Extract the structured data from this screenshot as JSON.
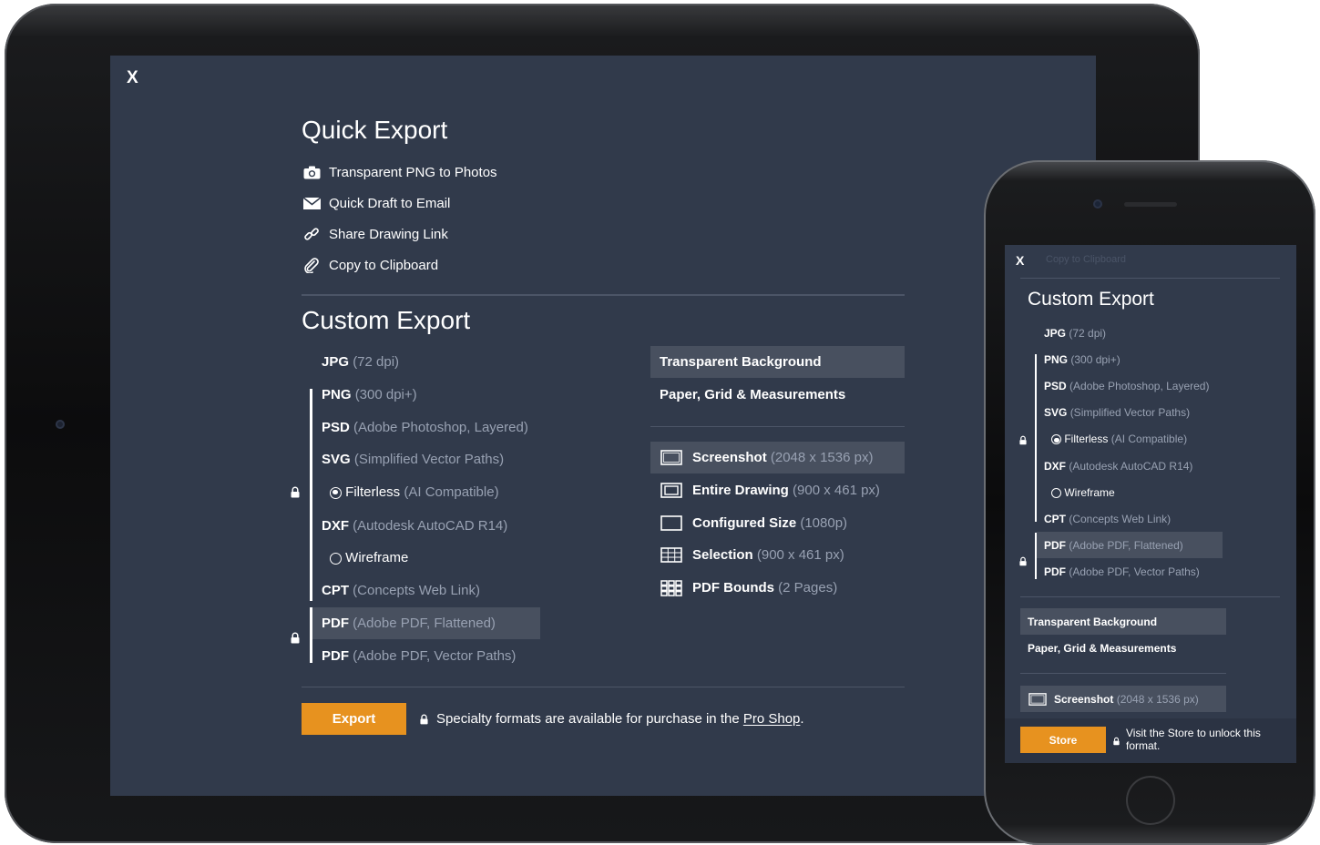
{
  "ipad": {
    "close_label": "X",
    "quick_export": {
      "title": "Quick Export",
      "items": [
        {
          "icon": "camera-icon",
          "label": "Transparent PNG to Photos"
        },
        {
          "icon": "envelope-icon",
          "label": "Quick Draft to Email"
        },
        {
          "icon": "link-icon",
          "label": "Share Drawing Link"
        },
        {
          "icon": "paperclip-icon",
          "label": "Copy to Clipboard"
        }
      ]
    },
    "custom_export": {
      "title": "Custom Export",
      "formats": [
        {
          "name": "JPG",
          "detail": "(72 dpi)"
        },
        {
          "name": "PNG",
          "detail": "(300 dpi+)"
        },
        {
          "name": "PSD",
          "detail": "(Adobe Photoshop, Layered)"
        },
        {
          "name": "SVG",
          "detail": "(Simplified Vector Paths)"
        },
        {
          "name": "Filterless",
          "detail": "(AI Compatible)"
        },
        {
          "name": "DXF",
          "detail": "(Autodesk AutoCAD R14)"
        },
        {
          "name": "Wireframe",
          "detail": ""
        },
        {
          "name": "CPT",
          "detail": "(Concepts Web Link)"
        },
        {
          "name": "PDF",
          "detail": "(Adobe PDF, Flattened)"
        },
        {
          "name": "PDF",
          "detail": "(Adobe PDF, Vector Paths)"
        }
      ],
      "background_options": [
        "Transparent Background",
        "Paper, Grid & Measurements"
      ],
      "size_options": [
        {
          "icon": "screenshot-icon",
          "name": "Screenshot",
          "detail": "(2048 x 1536 px)"
        },
        {
          "icon": "entire-drawing-icon",
          "name": "Entire Drawing",
          "detail": "(900 x 461 px)"
        },
        {
          "icon": "configured-size-icon",
          "name": "Configured Size",
          "detail": "(1080p)"
        },
        {
          "icon": "selection-grid-icon",
          "name": "Selection",
          "detail": "(900 x 461 px)"
        },
        {
          "icon": "pdf-bounds-icon",
          "name": "PDF Bounds",
          "detail": "(2 Pages)"
        }
      ]
    },
    "export_button": "Export",
    "note": {
      "text": "Specialty formats are available for purchase in the",
      "link": "Pro Shop",
      "end": "."
    }
  },
  "iphone": {
    "close_label": "X",
    "faded_label": "Copy to Clipboard",
    "title": "Custom Export",
    "formats": [
      {
        "name": "JPG",
        "detail": "(72 dpi)"
      },
      {
        "name": "PNG",
        "detail": "(300 dpi+)"
      },
      {
        "name": "PSD",
        "detail": "(Adobe Photoshop, Layered)"
      },
      {
        "name": "SVG",
        "detail": "(Simplified Vector Paths)"
      },
      {
        "name": "Filterless",
        "detail": "(AI Compatible)"
      },
      {
        "name": "DXF",
        "detail": "(Autodesk AutoCAD R14)"
      },
      {
        "name": "Wireframe",
        "detail": ""
      },
      {
        "name": "CPT",
        "detail": "(Concepts Web Link)"
      },
      {
        "name": "PDF",
        "detail": "(Adobe PDF, Flattened)"
      },
      {
        "name": "PDF",
        "detail": "(Adobe PDF, Vector Paths)"
      }
    ],
    "background_options": [
      "Transparent Background",
      "Paper, Grid & Measurements"
    ],
    "screenshot_option": {
      "name": "Screenshot",
      "detail": "(2048 x 1536 px)"
    },
    "store_button": "Store",
    "note": "Visit the Store to unlock this format."
  },
  "colors": {
    "screen_bg": "#313a4b",
    "highlight": "#48505f",
    "accent": "#e7921f",
    "muted_text": "#98a1b2"
  }
}
